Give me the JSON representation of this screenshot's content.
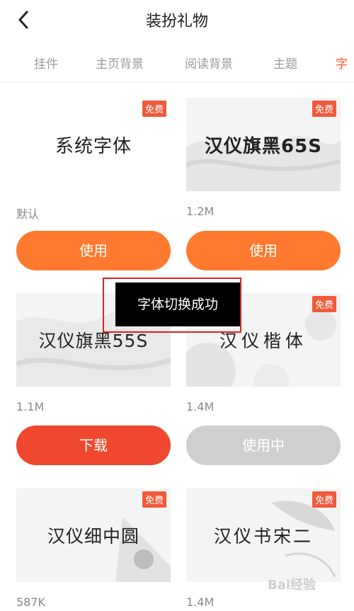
{
  "header": {
    "title": "装扮礼物",
    "back_icon": "chevron-left-icon"
  },
  "tabs": [
    {
      "label": "挂件"
    },
    {
      "label": "主页背景"
    },
    {
      "label": "阅读背景"
    },
    {
      "label": "主题"
    },
    {
      "label": "字"
    }
  ],
  "fonts": [
    {
      "name": "系统字体",
      "size": "默认",
      "badge": "免费",
      "action": "使用"
    },
    {
      "name": "汉仪旗黑65S",
      "size": "1.2M",
      "badge": "免费",
      "action": "使用"
    },
    {
      "name": "汉仪旗黑55S",
      "size": "1.1M",
      "badge": "",
      "action": "下载"
    },
    {
      "name": "汉仪楷体",
      "size": "1.4M",
      "badge": "免费",
      "action": "使用中"
    },
    {
      "name": "汉仪细中圆",
      "size": "587K",
      "badge": "免费",
      "action": ""
    },
    {
      "name": "汉仪书宋二",
      "size": "1.4M",
      "badge": "免费",
      "action": ""
    }
  ],
  "toast": {
    "text": "字体切换成功"
  },
  "watermark": {
    "text": "Bai经验"
  },
  "colors": {
    "accent_orange": "#ff7a2e",
    "download_red": "#f0482e",
    "in_use_gray": "#cfcfcf",
    "badge": "#f05a3a"
  }
}
